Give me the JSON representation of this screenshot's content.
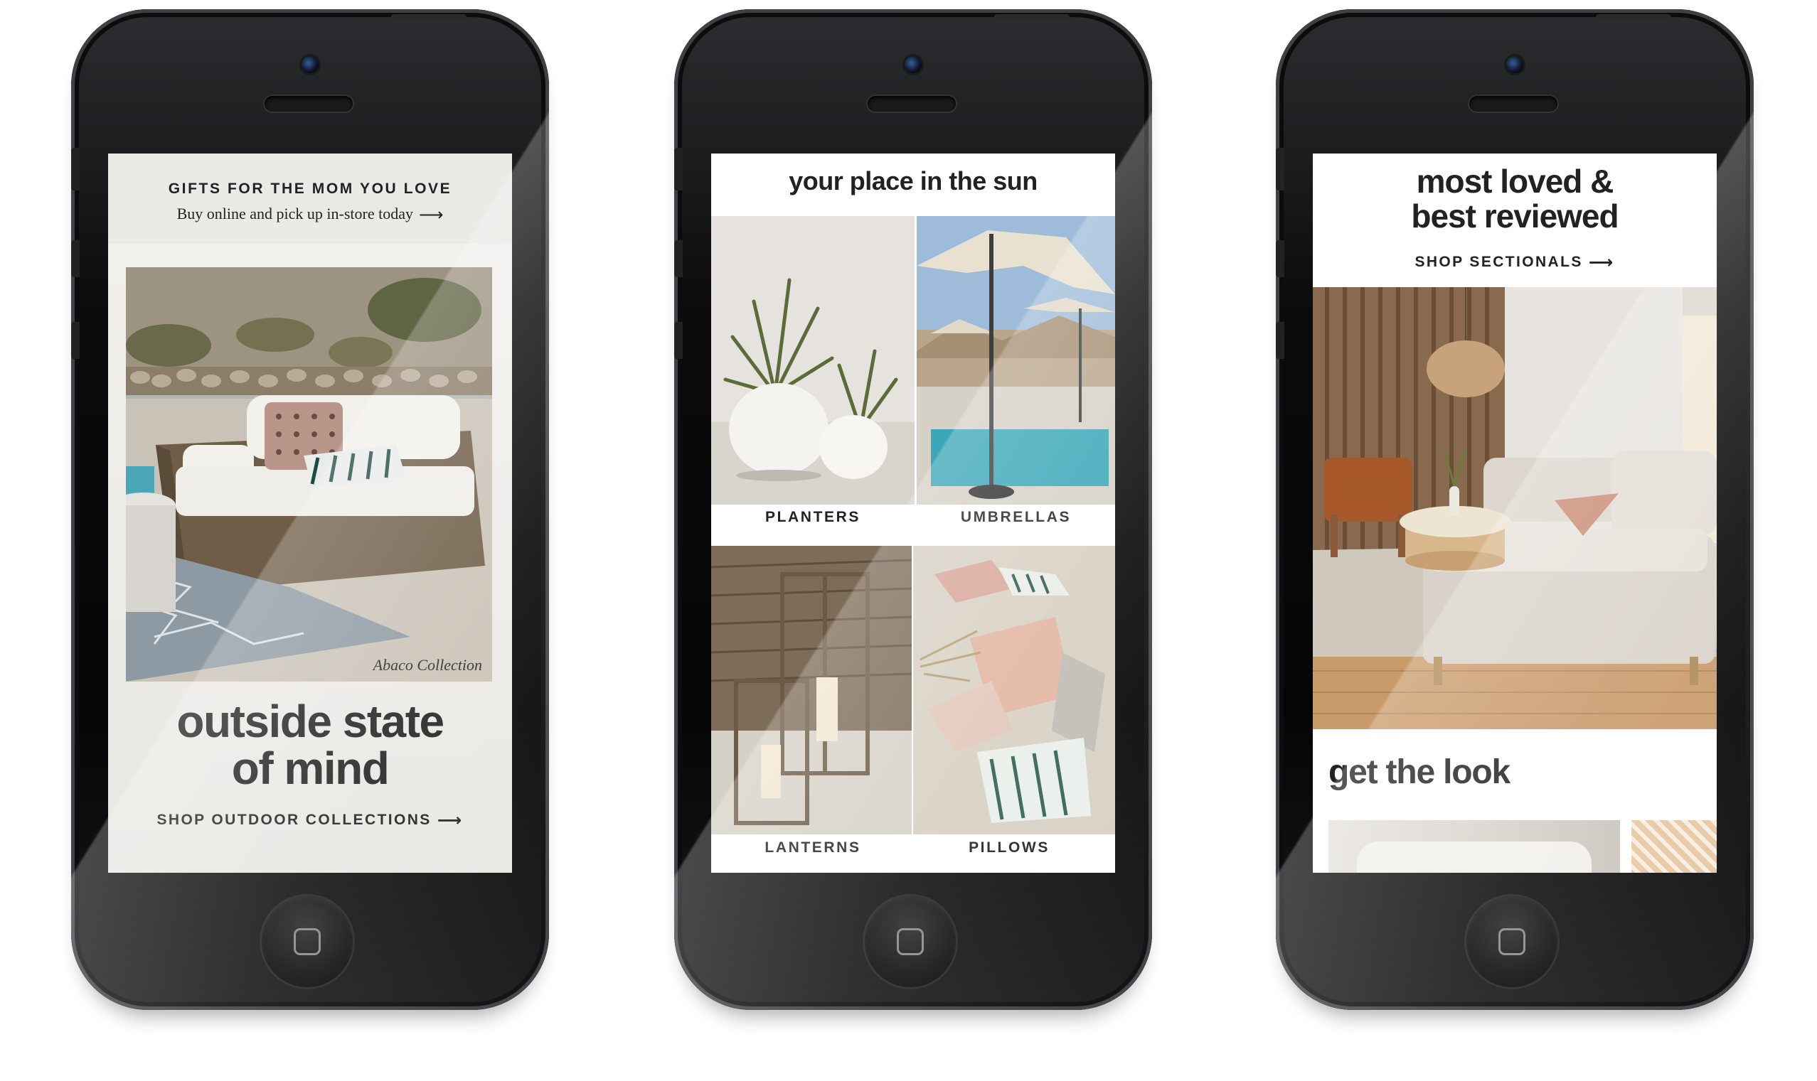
{
  "screen1": {
    "eyebrow": "GIFTS FOR THE MOM YOU LOVE",
    "subline": "Buy online and pick up in-store today",
    "photo_caption": "Abaco Collection",
    "headline_line1": "outside state",
    "headline_line2": "of mind",
    "cta": "SHOP OUTDOOR COLLECTIONS"
  },
  "screen2": {
    "title": "your place in the sun",
    "tiles": [
      {
        "label": "PLANTERS"
      },
      {
        "label": "UMBRELLAS"
      },
      {
        "label": "LANTERNS"
      },
      {
        "label": "PILLOWS"
      }
    ]
  },
  "screen3": {
    "title_line1": "most loved &",
    "title_line2": "best reviewed",
    "cta": "SHOP SECTIONALS",
    "section_title": "get the look"
  },
  "icons": {
    "arrow": "long-right-arrow-icon",
    "home": "home-button-icon"
  },
  "colors": {
    "text": "#222222",
    "banner_bg": "#eceae7",
    "phone_body": "#0b0b0d"
  }
}
